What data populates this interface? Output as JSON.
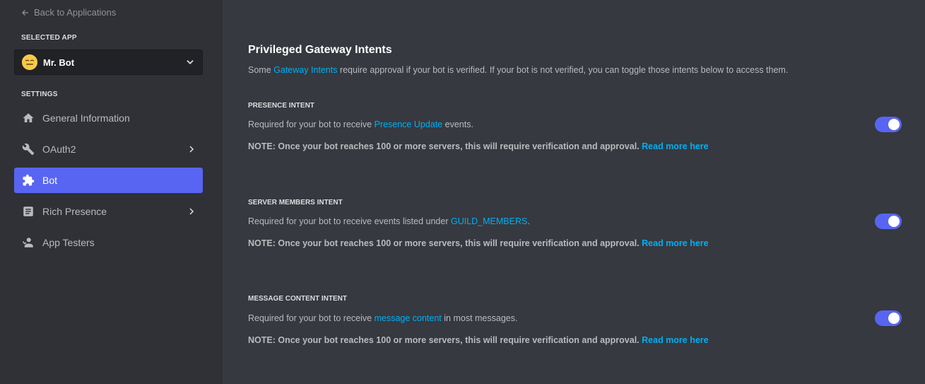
{
  "sidebar": {
    "back_label": "Back to Applications",
    "selected_app_label": "SELECTED APP",
    "app_name": "Mr. Bot",
    "settings_label": "SETTINGS",
    "items": [
      {
        "label": "General Information",
        "icon": "home-icon"
      },
      {
        "label": "OAuth2",
        "icon": "wrench-icon"
      },
      {
        "label": "Bot",
        "icon": "puzzle-icon"
      },
      {
        "label": "Rich Presence",
        "icon": "document-icon"
      },
      {
        "label": "App Testers",
        "icon": "person-icon"
      }
    ]
  },
  "main": {
    "title": "Privileged Gateway Intents",
    "desc_prefix": "Some ",
    "desc_link": "Gateway Intents",
    "desc_suffix": " require approval if your bot is verified. If your bot is not verified, you can toggle those intents below to access them.",
    "intents": [
      {
        "title": "PRESENCE INTENT",
        "desc_prefix": "Required for your bot to receive ",
        "desc_link": "Presence Update",
        "desc_suffix": " events.",
        "note": "NOTE: Once your bot reaches 100 or more servers, this will require verification and approval.",
        "note_link": "Read more here",
        "enabled": true
      },
      {
        "title": "SERVER MEMBERS INTENT",
        "desc_prefix": "Required for your bot to receive events listed under ",
        "desc_link": "GUILD_MEMBERS",
        "desc_suffix": ".",
        "note": "NOTE: Once your bot reaches 100 or more servers, this will require verification and approval.",
        "note_link": "Read more here",
        "enabled": true
      },
      {
        "title": "MESSAGE CONTENT INTENT",
        "desc_prefix": "Required for your bot to receive ",
        "desc_link": "message content",
        "desc_suffix": " in most messages.",
        "note": "NOTE: Once your bot reaches 100 or more servers, this will require verification and approval.",
        "note_link": "Read more here",
        "enabled": true
      }
    ]
  },
  "colors": {
    "accent": "#5865f2",
    "link": "#00aff4",
    "sidebar_bg": "#2f3136",
    "main_bg": "#36393f"
  }
}
